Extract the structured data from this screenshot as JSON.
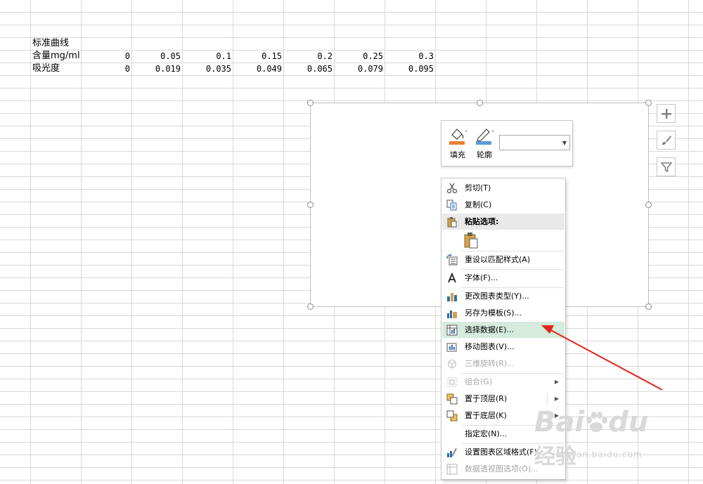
{
  "sheet": {
    "title": "标准曲线",
    "row1_label": "含量mg/ml",
    "row2_label": "吸光度",
    "row1_values": [
      "0",
      "0.05",
      "0.1",
      "0.15",
      "0.2",
      "0.25",
      "0.3"
    ],
    "row2_values": [
      "0",
      "0.019",
      "0.035",
      "0.049",
      "0.065",
      "0.079",
      "0.095"
    ]
  },
  "chart_side": {
    "icons": [
      "plus-icon",
      "brush-icon",
      "filter-icon"
    ]
  },
  "mini_toolbar": {
    "fill_label": "填充",
    "outline_label": "轮廓",
    "fill_color": "#ed7d31",
    "outline_color": "#5b9bd5",
    "dropdown_value": ""
  },
  "menu": {
    "cut": "剪切(T)",
    "copy": "复制(C)",
    "paste_options": "粘贴选项:",
    "reset_style": "重设以匹配样式(A)",
    "font": "字体(F)...",
    "change_chart_type": "更改图表类型(Y)...",
    "save_template": "另存为模板(S)...",
    "select_data": "选择数据(E)...",
    "move_chart": "移动图表(V)...",
    "rotate_3d": "三维旋转(R)...",
    "group": "组合(G)",
    "bring_front": "置于顶层(R)",
    "send_back": "置于底层(K)",
    "assign_macro": "指定宏(N)...",
    "format_chart_area": "设置图表区域格式(F)...",
    "pivot_options": "数据透视图选项(O)..."
  },
  "watermark": {
    "brand": "Bai",
    "brand2": "du",
    "suffix": "经验",
    "url": "jingyan.baidu.com"
  },
  "colors": {
    "highlight": "#d5ebdd",
    "arrow": "#e0261b",
    "grid": "#d9d9d9"
  }
}
